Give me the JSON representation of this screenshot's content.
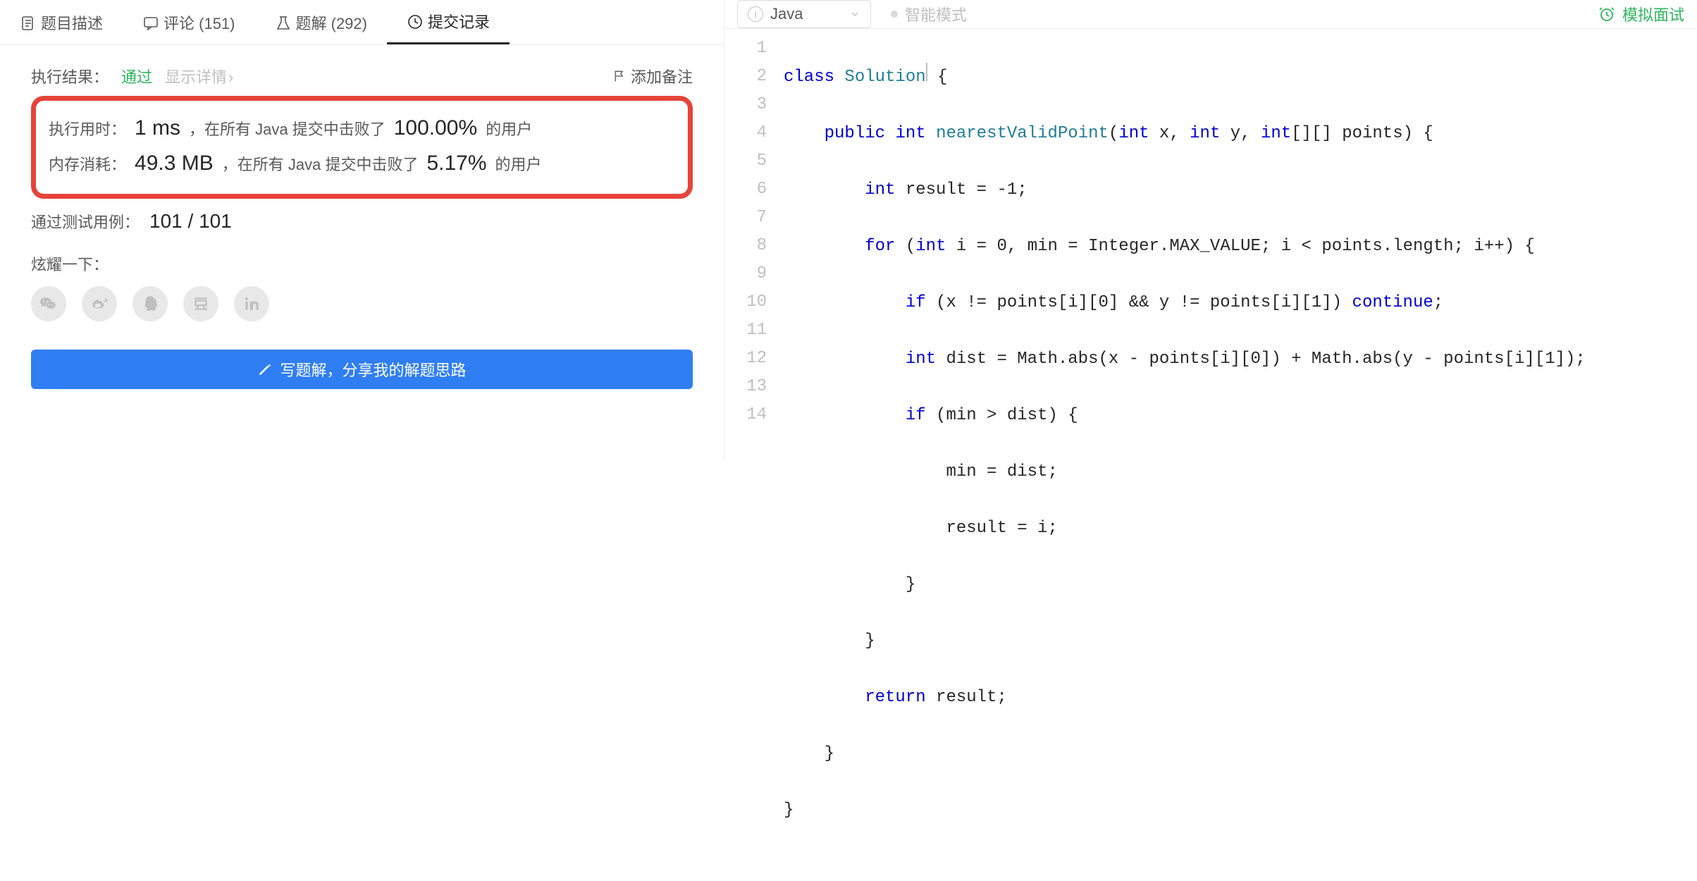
{
  "tabs": {
    "description": "题目描述",
    "comments": "评论 (151)",
    "solutions": "题解 (292)",
    "submissions": "提交记录"
  },
  "result": {
    "label": "执行结果：",
    "status": "通过",
    "show_details": "显示详情",
    "add_note": "添加备注"
  },
  "stats": {
    "time_label": "执行用时：",
    "time_value": "1 ms",
    "time_mid": "，在所有 Java 提交中击败了",
    "time_pct": "100.00%",
    "time_tail": "的用户",
    "mem_label": "内存消耗：",
    "mem_value": "49.3 MB",
    "mem_mid": "，在所有 Java 提交中击败了",
    "mem_pct": "5.17%",
    "mem_tail": "的用户"
  },
  "tests": {
    "label": "通过测试用例：",
    "value": "101 / 101"
  },
  "share": {
    "label": "炫耀一下："
  },
  "write_solution": "写题解，分享我的解题思路",
  "editor": {
    "language": "Java",
    "smart_mode": "智能模式",
    "mock_interview": "模拟面试"
  },
  "code": {
    "lines": 14,
    "l1_kw1": "class",
    "l1_ty": "Solution",
    "l1_rest": " {",
    "l2_kw1": "public",
    "l2_kw2": "int",
    "l2_fn": "nearestValidPoint",
    "l2_p1_t": "int",
    "l2_p1_n": " x, ",
    "l2_p2_t": "int",
    "l2_p2_n": " y, ",
    "l2_p3_t": "int",
    "l2_p3_n": "[][] points) {",
    "l3_t": "int",
    "l3_rest": " result = -1;",
    "l4_for": "for",
    "l4_a": " (",
    "l4_t1": "int",
    "l4_b": " i = 0, min = Integer.MAX_VALUE; i < points.length; i++) {",
    "l5_if": "if",
    "l5_a": " (x != points[i][0] && y != points[i][1]) ",
    "l5_cont": "continue",
    "l5_b": ";",
    "l6_t": "int",
    "l6_rest": " dist = Math.abs(x - points[i][0]) + Math.abs(y - points[i][1]);",
    "l7_if": "if",
    "l7_rest": " (min > dist) {",
    "l8": "min = dist;",
    "l9": "result = i;",
    "l10": "}",
    "l11": "}",
    "l12_ret": "return",
    "l12_rest": " result;",
    "l13": "}",
    "l14": "}"
  }
}
